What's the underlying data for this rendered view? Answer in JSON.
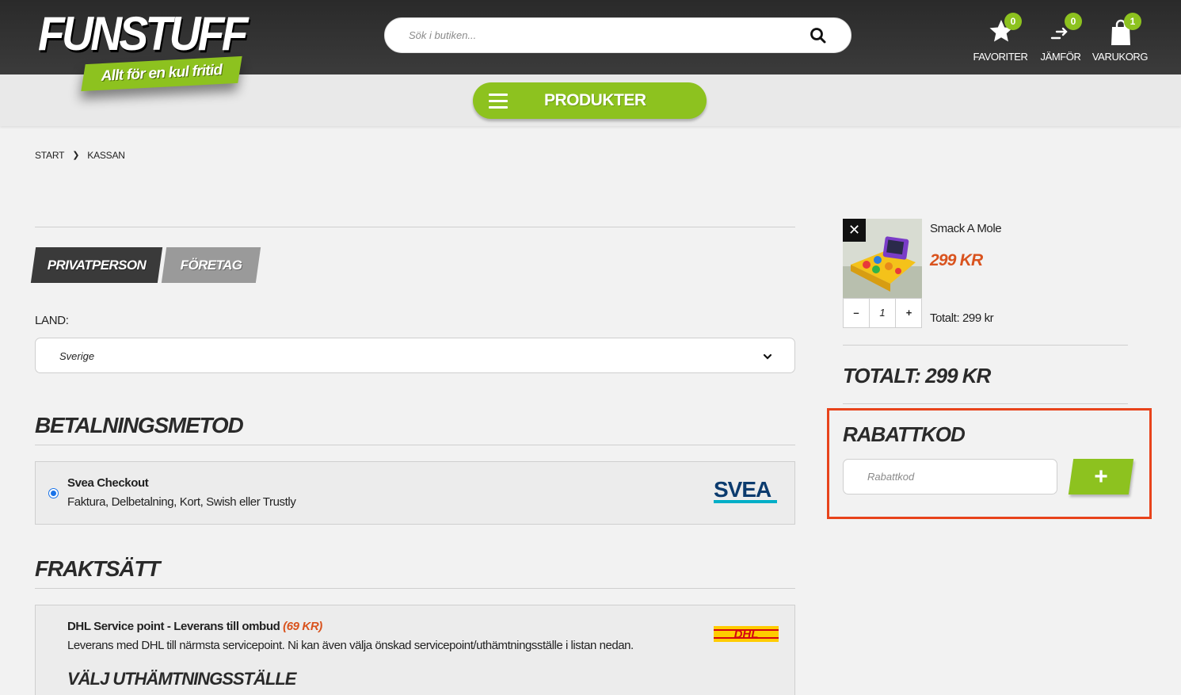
{
  "brand": {
    "logo_text": "FUNSTUFF",
    "tagline": "Allt för en kul fritid",
    "accent_color": "#8dc21f",
    "price_color": "#d9531e"
  },
  "search": {
    "placeholder": "Sök i butiken..."
  },
  "header_actions": [
    {
      "label": "FAVORITER",
      "count": "0",
      "icon": "star-icon"
    },
    {
      "label": "JÄMFÖR",
      "count": "0",
      "icon": "compare-icon"
    },
    {
      "label": "VARUKORG",
      "count": "1",
      "icon": "shopping-bag-icon"
    }
  ],
  "nav": {
    "products_label": "PRODUKTER"
  },
  "breadcrumb": [
    "START",
    "KASSAN"
  ],
  "customer_tabs": {
    "private": "PRIVATPERSON",
    "company": "FÖRETAG"
  },
  "country": {
    "label": "LAND:",
    "selected": "Sverige"
  },
  "payment": {
    "heading": "BETALNINGSMETOD",
    "method_name": "Svea Checkout",
    "method_desc": "Faktura, Delbetalning, Kort, Swish eller Trustly",
    "logo_text": "SVEA"
  },
  "shipping": {
    "heading": "FRAKTSÄTT",
    "option_name": "DHL Service point - Leverans till ombud",
    "option_price": "(69 KR)",
    "option_desc": "Leverans med DHL till närmsta servicepoint. Ni kan även välja önskad servicepoint/uthämtningsställe i listan nedan.",
    "pickup_heading": "VÄLJ UTHÄMTNINGSSTÄLLE",
    "logo_text": "DHL"
  },
  "cart": {
    "remove_symbol": "✕",
    "item_name": "Smack A Mole",
    "item_price": "299 KR",
    "qty_minus": "–",
    "quantity": "1",
    "qty_plus": "+",
    "item_total": "Totalt: 299 kr",
    "grand_total": "TOTALT: 299 KR"
  },
  "discount": {
    "heading": "RABATTKOD",
    "placeholder": "Rabattkod",
    "add_symbol": "+",
    "highlight_color": "#e8431b"
  }
}
